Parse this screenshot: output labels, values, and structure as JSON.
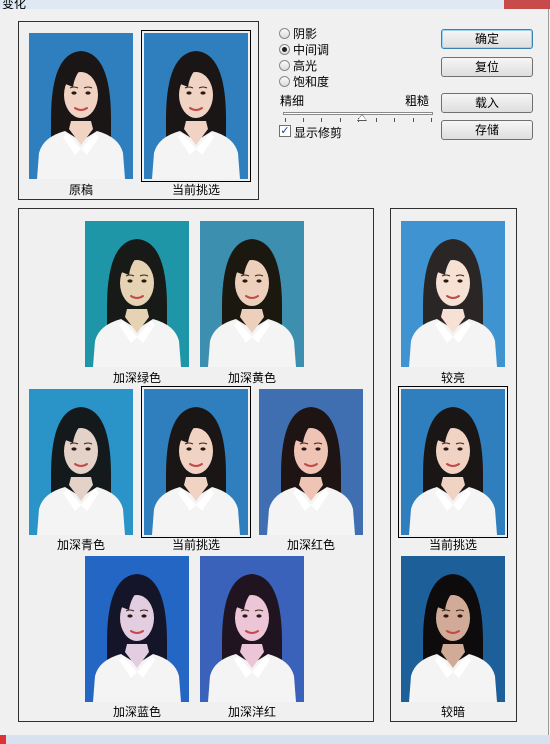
{
  "window": {
    "title": "变化"
  },
  "original_panel": {
    "items": [
      {
        "label": "原稿",
        "bg": "#2f7fbf",
        "tint": "none"
      },
      {
        "label": "当前挑选",
        "bg": "#2f7fbf",
        "tint": "none"
      }
    ]
  },
  "options": {
    "radios": [
      {
        "label": "阴影",
        "selected": false
      },
      {
        "label": "中间调",
        "selected": true
      },
      {
        "label": "高光",
        "selected": false
      },
      {
        "label": "饱和度",
        "selected": false
      }
    ],
    "slider": {
      "left_label": "精细",
      "right_label": "粗糙",
      "value_fraction": 0.5
    },
    "show_clipping": {
      "label": "显示修剪",
      "checked": true
    }
  },
  "buttons": {
    "ok": "确定",
    "reset": "复位",
    "load": "载入",
    "save": "存储"
  },
  "variations_panel": {
    "items": [
      {
        "label": "加深绿色",
        "bg": "#1f96a8"
      },
      {
        "label": "加深黄色",
        "bg": "#3d8fb0"
      },
      {
        "label": "加深青色",
        "bg": "#2a94c8"
      },
      {
        "label": "当前挑选",
        "bg": "#2f7fbf"
      },
      {
        "label": "加深红色",
        "bg": "#3f6fb0"
      },
      {
        "label": "加深蓝色",
        "bg": "#2466c4"
      },
      {
        "label": "加深洋红",
        "bg": "#3b62bb"
      }
    ]
  },
  "brightness_panel": {
    "items": [
      {
        "label": "较亮",
        "bg": "#3f93d0"
      },
      {
        "label": "当前挑选",
        "bg": "#2f7fbf"
      },
      {
        "label": "较暗",
        "bg": "#1c5f99"
      }
    ]
  }
}
